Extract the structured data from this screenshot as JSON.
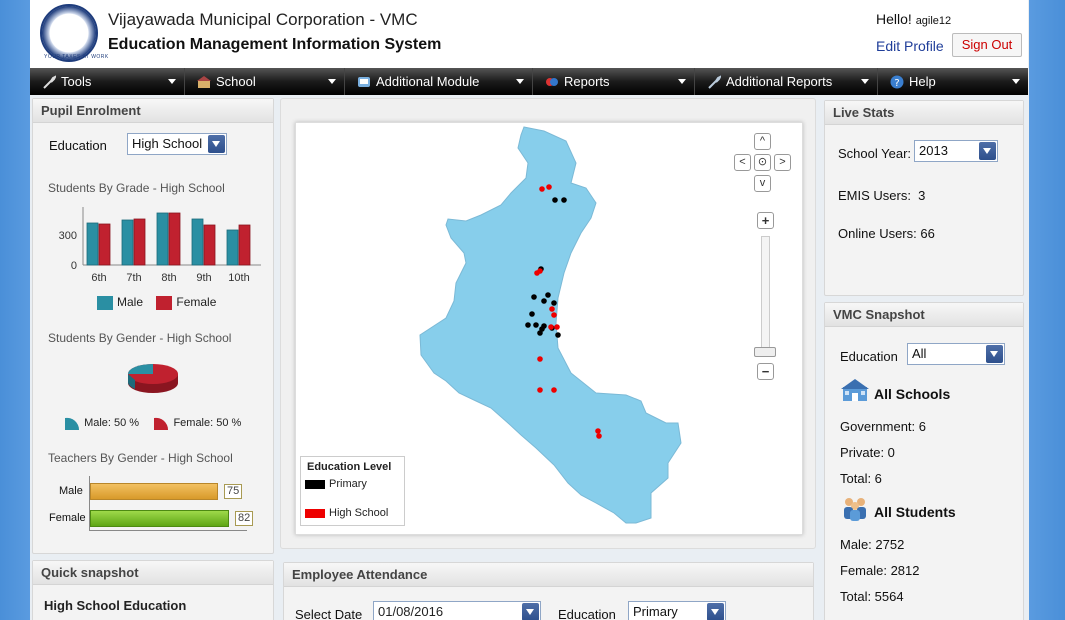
{
  "header": {
    "org_title": "Vijayawada Municipal Corporation - VMC",
    "system_title": "Education Management Information System",
    "logo_motto": "YOUR TAXES AT WORK",
    "greeting": "Hello!",
    "username": "agile12",
    "edit_profile": "Edit Profile",
    "sign_out": "Sign Out"
  },
  "menu": [
    {
      "label": "Tools",
      "icon": "wrench-icon"
    },
    {
      "label": "School",
      "icon": "school-icon"
    },
    {
      "label": "Additional Module",
      "icon": "module-icon"
    },
    {
      "label": "Reports",
      "icon": "reports-icon"
    },
    {
      "label": "Additional Reports",
      "icon": "additional-reports-icon"
    },
    {
      "label": "Help",
      "icon": "help-icon"
    }
  ],
  "pupil": {
    "title": "Pupil Enrolment",
    "education_label": "Education",
    "education_value": "High School",
    "grade_title": "Students By Grade - High School",
    "gender_title": "Students By Gender - High School",
    "teachers_title": "Teachers By Gender - High School",
    "grade_legend_male": "Male",
    "grade_legend_female": "Female",
    "pie_male": "Male: 50 %",
    "pie_female": "Female: 50 %",
    "teacher_male_label": "Male",
    "teacher_female_label": "Female",
    "teacher_male_value": "75",
    "teacher_female_value": "82"
  },
  "chart_data": {
    "type": "bar",
    "categories": [
      "6th",
      "7th",
      "8th",
      "9th",
      "10th"
    ],
    "series": [
      {
        "name": "Male",
        "values": [
          420,
          450,
          520,
          460,
          350
        ]
      },
      {
        "name": "Female",
        "values": [
          410,
          460,
          520,
          400,
          400
        ]
      }
    ],
    "ylim": [
      0,
      560
    ],
    "yticks": [
      "0",
      "300"
    ],
    "colors": {
      "male": "#2a8fa3",
      "female": "#c0212f"
    }
  },
  "teacher_chart": {
    "male": 75,
    "female": 82,
    "max": 100
  },
  "map": {
    "legend_title": "Education Level",
    "legend_primary": "Primary",
    "legend_high": "High School",
    "nav": {
      "up": "^",
      "left": "<",
      "center": "⊙",
      "right": ">",
      "down": "v",
      "zoom_in": "+",
      "zoom_out": "−"
    }
  },
  "live_stats": {
    "title": "Live Stats",
    "school_year_label": "School Year:",
    "school_year_value": "2013",
    "emis_users": "EMIS Users:  3",
    "online_users": "Online Users: 66"
  },
  "snapshot": {
    "title": "VMC Snapshot",
    "education_label": "Education",
    "education_value": "All",
    "schools_title": "All Schools",
    "government": "Government: 6",
    "private": "Private: 0",
    "total_schools": "Total: 6",
    "students_title": "All Students",
    "male": "Male: 2752",
    "female": "Female: 2812",
    "total_students": "Total: 5564"
  },
  "quick": {
    "title": "Quick snapshot",
    "subtitle": "High School Education"
  },
  "attendance": {
    "title": "Employee Attendance",
    "date_label": "Select Date",
    "date_value": "01/08/2016",
    "education_label": "Education",
    "education_value": "Primary"
  }
}
